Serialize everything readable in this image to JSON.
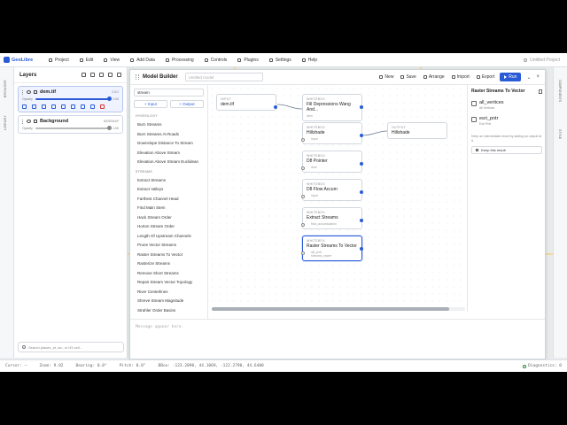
{
  "app": {
    "name": "GeoLibre",
    "project": "Untitled Project"
  },
  "menu": [
    "Project",
    "Edit",
    "View",
    "Add Data",
    "Processing",
    "Controls",
    "Plugins",
    "Settings",
    "Help"
  ],
  "left_strip": {
    "browser": "BROWSER",
    "library": "LIBRARY"
  },
  "layers_panel": {
    "title": "Layers",
    "layers": [
      {
        "name": "dem.tif",
        "kind": "COG",
        "opacity_label": "Opacity",
        "opacity_value": "1.00",
        "opacity": 1.0
      },
      {
        "name": "Background",
        "kind": "BASEMAP",
        "opacity_label": "Opacity",
        "opacity_value": "1.00",
        "opacity": 1.0
      }
    ],
    "search_placeholder": "Search places, pt, lon, or H3 cell..."
  },
  "right_strip": {
    "components": "COMPONENTS",
    "style": "STYLE"
  },
  "model_builder": {
    "title": "Model Builder",
    "model_name_placeholder": "Untitled model",
    "toolbar": {
      "new": "New",
      "save": "Save",
      "arrange": "Arrange",
      "import": "Import",
      "export": "Export",
      "run": "Run"
    },
    "palette": {
      "search_value": "stream",
      "add_input": "+ Input",
      "add_output": "+ Output",
      "categories": [
        {
          "name": "HYDROLOGY",
          "items": [
            "Burn Streams",
            "Burn Streams At Roads",
            "Downslope Distance To Stream",
            "Elevation Above Stream",
            "Elevation Above Stream Euclidean"
          ]
        },
        {
          "name": "STREAMS",
          "items": [
            "Extract Streams",
            "Extract Valleys",
            "Farthest Channel Head",
            "Find Main Stem",
            "Hack Stream Order",
            "Horton Stream Order",
            "Length Of Upstream Channels",
            "Prune Vector Streams",
            "Raster Streams To Vector",
            "Rasterize Streams",
            "Remove Short Streams",
            "Repair Stream Vector Topology",
            "River Centerlines",
            "Shreve Stream Magnitude",
            "Strahler Order Basins"
          ]
        }
      ]
    },
    "nodes": [
      {
        "id": "input",
        "kind": "INPUT",
        "title": "dem.tif",
        "port": ""
      },
      {
        "id": "fill",
        "kind": "WHITEBOX",
        "title": "Fill Depressions Wang And...",
        "port": "dem"
      },
      {
        "id": "hillshade",
        "kind": "WHITEBOX",
        "title": "Hillshade",
        "port": "input"
      },
      {
        "id": "output",
        "kind": "OUTPUT",
        "title": "Hillshade",
        "port": ""
      },
      {
        "id": "d8p",
        "kind": "WHITEBOX",
        "title": "D8 Pointer",
        "port": "dem"
      },
      {
        "id": "d8fa",
        "kind": "WHITEBOX",
        "title": "D8 Flow Accum",
        "port": "input"
      },
      {
        "id": "extract",
        "kind": "WHITEBOX",
        "title": "Extract Streams",
        "port": "flow_accumulation"
      },
      {
        "id": "r2v",
        "kind": "WHITEBOX",
        "title": "Raster Streams To Vector",
        "port": "d8_pntr",
        "port2": "streams_raster"
      }
    ],
    "inspector": {
      "title": "Raster Streams To Vector",
      "outputs": [
        {
          "name": "all_vertices",
          "sub": "All Vertices"
        },
        {
          "name": "esri_pntr",
          "sub": "Esri Pntr"
        }
      ],
      "note": "Keep an intermediate result by adding an output for it.",
      "keep_label": "Keep this result"
    },
    "log_placeholder": "Message appear here."
  },
  "status": {
    "cursor": "Cursor: –",
    "zoom": "Zoom: 9.82",
    "bearing": "Bearing: 0.0°",
    "pitch": "Pitch: 0.0°",
    "bbox": "BBox: -123.2090, 44.1069, -122.2790, 44.6400",
    "diagnostics": "Diagnostics: 0"
  },
  "colors": {
    "accent": "#2a5bd7",
    "danger": "#dd3333"
  }
}
